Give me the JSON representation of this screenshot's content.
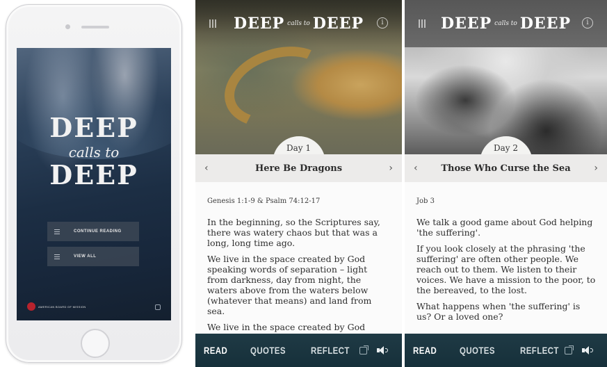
{
  "splash": {
    "title_line1": "DEEP",
    "title_line2": "calls to",
    "title_line3": "DEEP",
    "continue_label": "CONTINUE READING",
    "view_all_label": "VIEW ALL",
    "org_name": "AMERICAN BOARD OF MISSION"
  },
  "brand": {
    "left": "DEEP",
    "middle": "calls to",
    "right": "DEEP"
  },
  "panels": [
    {
      "day": "Day 1",
      "title": "Here Be Dragons",
      "reference": "Genesis 1:1-9 & Psalm 74:12-17",
      "paragraphs": [
        "In the beginning, so the Scriptures say, there was watery chaos but that was a long, long time ago.",
        "We live in the space created by God speaking words of separation – light from darkness, day from night, the waters above from the waters below (whatever that means) and land from sea.",
        "We live in the space created by God"
      ]
    },
    {
      "day": "Day 2",
      "title": "Those Who Curse the Sea",
      "reference": "Job 3",
      "paragraphs": [
        "We talk a good game about God helping 'the suffering'.",
        "If you look closely at the phrasing 'the suffering' are often other people. We reach out to them. We listen to their voices. We have a mission to the poor, to the bereaved, to the lost.",
        "What happens when 'the suffering' is us? Or a loved one?"
      ]
    }
  ],
  "tabs": {
    "read": "READ",
    "quotes": "QUOTES",
    "reflect": "REFLECT"
  },
  "icons": {
    "info_glyph": "i",
    "prev_glyph": "‹",
    "next_glyph": "›"
  },
  "colors": {
    "tabbar": "#1f3a45",
    "title_bar": "#ecebea",
    "splash_accent": "#b8232d"
  }
}
